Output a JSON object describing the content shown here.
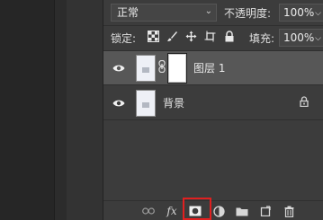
{
  "blend_mode": {
    "value": "正常"
  },
  "opacity": {
    "label": "不透明度:",
    "value": "100%"
  },
  "lock": {
    "label": "锁定:",
    "icons": [
      "lock-transparent-icon",
      "lock-brush-icon",
      "lock-move-icon",
      "lock-artboard-icon",
      "lock-all-icon"
    ]
  },
  "fill": {
    "label": "填充:",
    "value": "100%"
  },
  "layers": [
    {
      "name": "图层 1",
      "visible": true,
      "selected": true,
      "has_mask": true
    },
    {
      "name": "背景",
      "visible": true,
      "selected": false,
      "locked": true
    }
  ],
  "bottom_bar": {
    "icons": [
      "link-layers-icon",
      "fx-icon",
      "add-mask-icon",
      "adjustment-layer-icon",
      "new-group-icon",
      "new-layer-icon",
      "delete-icon"
    ],
    "fx_label": "fx",
    "highlight_color": "#e02020"
  }
}
